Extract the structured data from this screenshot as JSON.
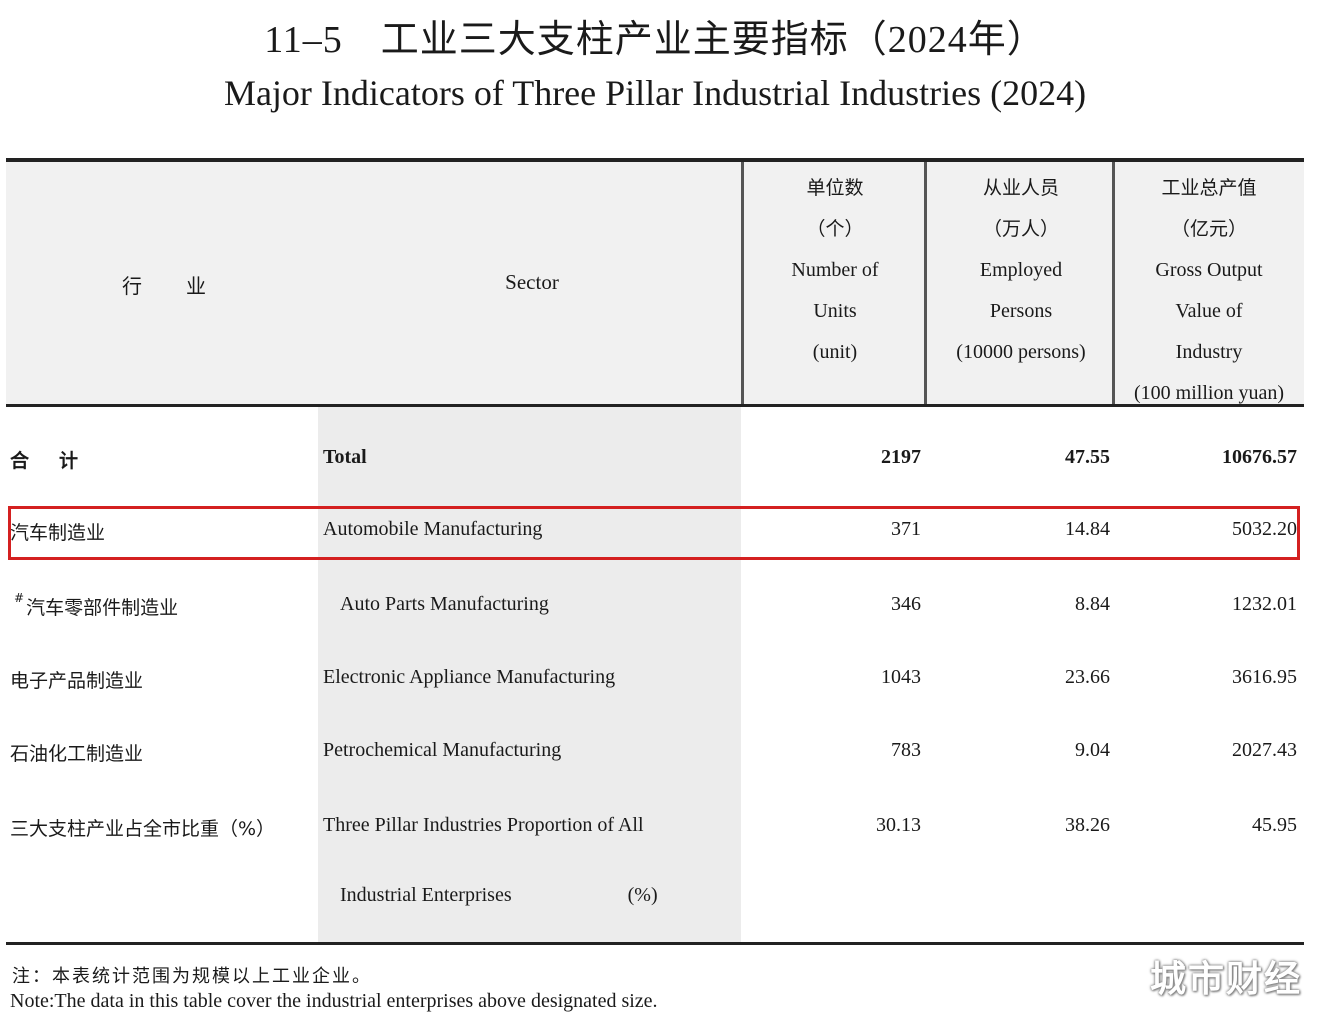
{
  "title": {
    "number": "11–5",
    "zh": "工业三大支柱产业主要指标（2024年）",
    "en": "Major Indicators of Three Pillar Industrial Industries (2024)"
  },
  "header": {
    "sector_zh_a": "行",
    "sector_zh_b": "业",
    "sector_en": "Sector",
    "columns": [
      {
        "zh": "单位数",
        "unit_zh": "（个）",
        "en1": "Number of",
        "en2": "Units",
        "en3": "(unit)",
        "en4": ""
      },
      {
        "zh": "从业人员",
        "unit_zh": "（万人）",
        "en1": "Employed",
        "en2": "Persons",
        "en3": "(10000 persons)",
        "en4": ""
      },
      {
        "zh": "工业总产值",
        "unit_zh": "（亿元）",
        "en1": "Gross Output",
        "en2": "Value of",
        "en3": "Industry",
        "en4": "(100 million yuan)"
      }
    ]
  },
  "rows": [
    {
      "zh_a": "合",
      "zh_b": "计",
      "en": "Total",
      "units": "2197",
      "employed": "47.55",
      "output": "10676.57"
    },
    {
      "zh": "汽车制造业",
      "en": "Automobile Manufacturing",
      "units": "371",
      "employed": "14.84",
      "output": "5032.20"
    },
    {
      "mark": "#",
      "zh": "汽车零部件制造业",
      "en": "Auto Parts Manufacturing",
      "units": "346",
      "employed": "8.84",
      "output": "1232.01"
    },
    {
      "zh": "电子产品制造业",
      "en": "Electronic Appliance Manufacturing",
      "units": "1043",
      "employed": "23.66",
      "output": "3616.95"
    },
    {
      "zh": "石油化工制造业",
      "en": "Petrochemical Manufacturing",
      "units": "783",
      "employed": "9.04",
      "output": "2027.43"
    },
    {
      "zh": "三大支柱产业占全市比重（%）",
      "en": "Three Pillar Industries Proportion of All",
      "en_cont": "Industrial Enterprises",
      "pct": "(%)",
      "units": "30.13",
      "employed": "38.26",
      "output": "45.95"
    }
  ],
  "highlight_color": "#d42020",
  "note": {
    "zh": "注：本表统计范围为规模以上工业企业。",
    "en": "Note:The data in this table cover the industrial enterprises above designated size."
  },
  "watermark": "城市财经"
}
